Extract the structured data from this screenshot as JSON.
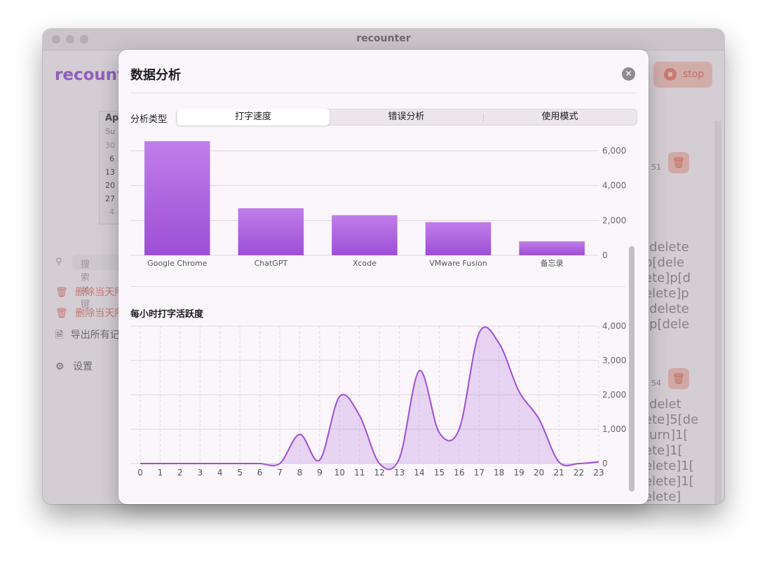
{
  "window": {
    "title": "recounter"
  },
  "background_app": {
    "brand": "recounte",
    "stop_label": "stop",
    "calendar": {
      "month_fragment": "Apr",
      "weekday_fragment": "Su",
      "days": [
        "30",
        "6",
        "13",
        "20",
        "27",
        "4"
      ]
    },
    "search_placeholder": "搜索关键",
    "actions": [
      {
        "label": "删除当天所",
        "icon": "trash-icon",
        "color": "#e08a80"
      },
      {
        "label": "删除当天所",
        "icon": "trash-icon",
        "color": "#e08a80"
      },
      {
        "label": "导出所有记",
        "icon": "document-icon",
        "color": "#777777"
      }
    ],
    "settings_label": "设置",
    "record_fragments_top": [
      "]",
      "]",
      "",
      "[delete",
      "p[dele",
      "ete]p[d",
      "elete]p",
      "[delete",
      "]p[dele"
    ],
    "record_fragments_bottom": [
      "[delet",
      "ete]5[de",
      "turn]1[",
      "ete]1[",
      "elete]1[",
      "elete]1[",
      "elete]"
    ],
    "timestamp_fragments": [
      "51",
      "54"
    ]
  },
  "dialog": {
    "title": "数据分析",
    "segment_label": "分析类型",
    "segments": [
      "打字速度",
      "错误分析",
      "使用模式"
    ],
    "selected_segment": "打字速度",
    "hourly_title": "每小时打字活跃度"
  },
  "chart_data": [
    {
      "type": "bar",
      "categories": [
        "Google Chrome",
        "ChatGPT",
        "Xcode",
        "VMware Fusion",
        "备忘录"
      ],
      "values": [
        6550,
        2700,
        2300,
        1900,
        800
      ],
      "ylim": [
        0,
        6000
      ],
      "yticks": [
        "0",
        "2,000",
        "4,000",
        "6,000"
      ],
      "grid": true,
      "color": "#a855db"
    },
    {
      "type": "area",
      "x": [
        "0",
        "1",
        "2",
        "3",
        "4",
        "5",
        "6",
        "7",
        "8",
        "9",
        "10",
        "11",
        "12",
        "13",
        "14",
        "15",
        "16",
        "17",
        "18",
        "19",
        "20",
        "21",
        "22",
        "23"
      ],
      "values": [
        0,
        0,
        0,
        0,
        0,
        0,
        0,
        0,
        850,
        100,
        1950,
        1400,
        0,
        150,
        2700,
        900,
        1000,
        3800,
        3500,
        2100,
        1300,
        50,
        0,
        50
      ],
      "ylim": [
        0,
        4000
      ],
      "yticks": [
        "0",
        "1,000",
        "2,000",
        "3,000",
        "4,000"
      ],
      "grid": true,
      "color": "#a855db"
    }
  ]
}
